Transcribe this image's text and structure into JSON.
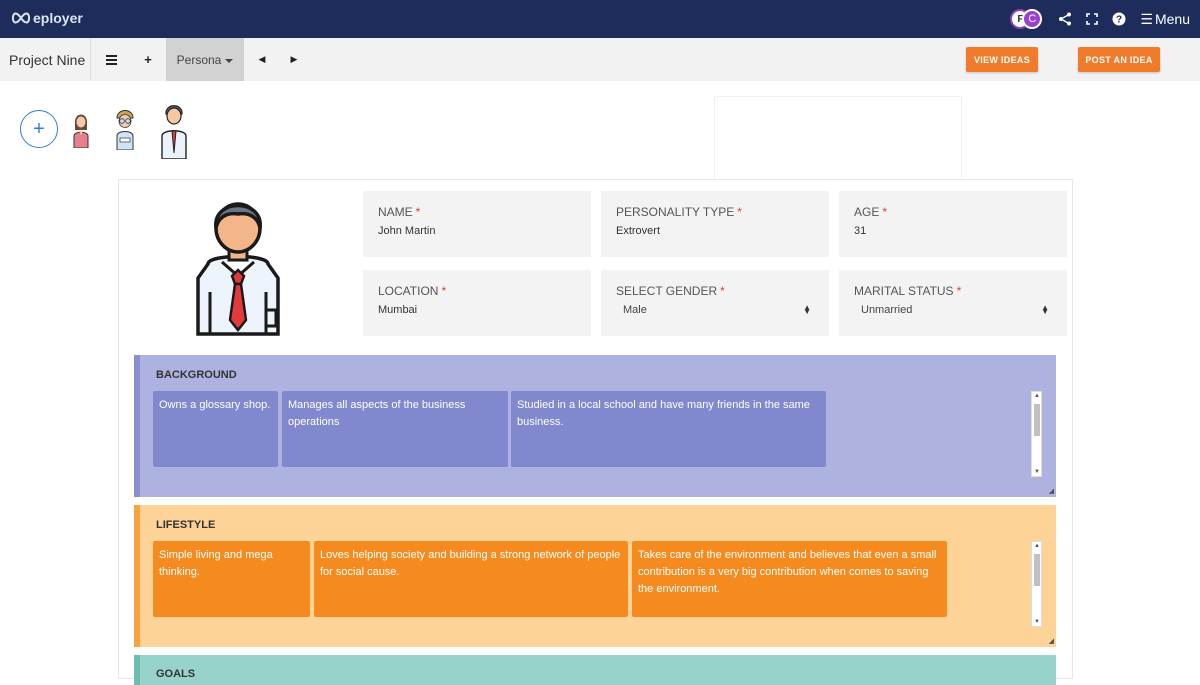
{
  "app": {
    "logo_text": "eployer"
  },
  "header": {
    "avatar1_initial": "F",
    "avatar2_initial": "C",
    "menu_label": "Menu",
    "icons": [
      "share-icon",
      "fullscreen-icon",
      "help-icon",
      "hamburger-icon"
    ]
  },
  "toolbar": {
    "project_name": "Project Nine",
    "persona_label": "Persona",
    "view_ideas": "VIEW IDEAS",
    "post_idea": "POST AN IDEA"
  },
  "form": {
    "name": {
      "label": "NAME",
      "value": "John Martin"
    },
    "personality": {
      "label": "PERSONALITY TYPE",
      "value": "Extrovert"
    },
    "age": {
      "label": "AGE",
      "value": "31"
    },
    "location": {
      "label": "LOCATION",
      "value": "Mumbai"
    },
    "gender": {
      "label": "SELECT GENDER",
      "value": "Male"
    },
    "marital": {
      "label": "MARITAL STATUS",
      "value": "Unmarried"
    },
    "required_mark": "*"
  },
  "background": {
    "title": "BACKGROUND",
    "notes": [
      "Owns a glossary shop.",
      "Manages all aspects of the business operations",
      "Studied in a local school and have many friends in the same business."
    ]
  },
  "lifestyle": {
    "title": "LIFESTYLE",
    "notes": [
      "Simple living and mega thinking.",
      "Loves helping society and building a strong network of people for social cause.",
      "Takes care of the environment and believes that even a small contribution is a very big contribution when comes to saving the environment."
    ]
  },
  "goals": {
    "title": "GOALS"
  },
  "colors": {
    "appbar": "#1d2c5a",
    "accent_orange": "#f07b2b",
    "background_section": "#adb2e0",
    "lifestyle_section": "#fdd397",
    "goals_section": "#98d3cb"
  }
}
